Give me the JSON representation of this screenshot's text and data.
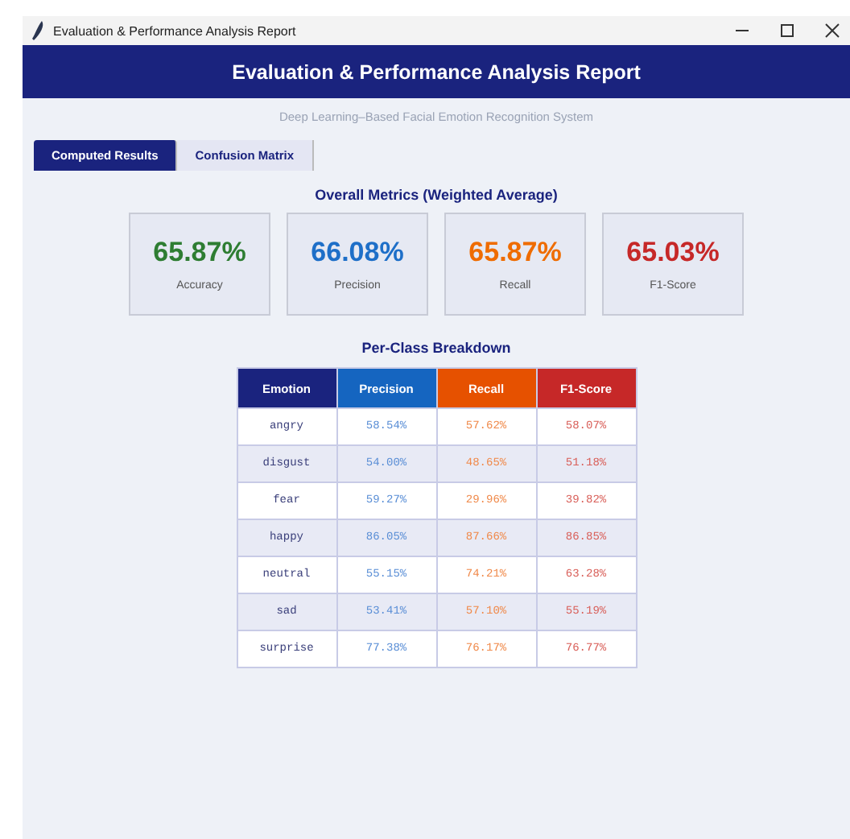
{
  "window": {
    "title": "Evaluation & Performance Analysis Report"
  },
  "header": {
    "title": "Evaluation & Performance Analysis Report",
    "subtitle": "Deep Learning–Based Facial Emotion Recognition System"
  },
  "tabs": [
    {
      "label": "Computed Results",
      "selected": true
    },
    {
      "label": "Confusion Matrix",
      "selected": false
    }
  ],
  "overall": {
    "title": "Overall Metrics (Weighted Average)",
    "metrics": [
      {
        "value": "65.87%",
        "label": "Accuracy",
        "color": "#2e7d32"
      },
      {
        "value": "66.08%",
        "label": "Precision",
        "color": "#1e6fc8"
      },
      {
        "value": "65.87%",
        "label": "Recall",
        "color": "#ef6c00"
      },
      {
        "value": "65.03%",
        "label": "F1-Score",
        "color": "#c62828"
      }
    ]
  },
  "breakdown": {
    "title": "Per-Class Breakdown",
    "columns": [
      {
        "label": "Emotion",
        "color": "#1a237e"
      },
      {
        "label": "Precision",
        "color": "#1565c0"
      },
      {
        "label": "Recall",
        "color": "#e65100"
      },
      {
        "label": "F1-Score",
        "color": "#c62828"
      }
    ],
    "rows": [
      [
        "angry",
        "58.54%",
        "57.62%",
        "58.07%"
      ],
      [
        "disgust",
        "54.00%",
        "48.65%",
        "51.18%"
      ],
      [
        "fear",
        "59.27%",
        "29.96%",
        "39.82%"
      ],
      [
        "happy",
        "86.05%",
        "87.66%",
        "86.85%"
      ],
      [
        "neutral",
        "55.15%",
        "74.21%",
        "63.28%"
      ],
      [
        "sad",
        "53.41%",
        "57.10%",
        "55.19%"
      ],
      [
        "surprise",
        "77.38%",
        "76.17%",
        "76.77%"
      ]
    ]
  }
}
